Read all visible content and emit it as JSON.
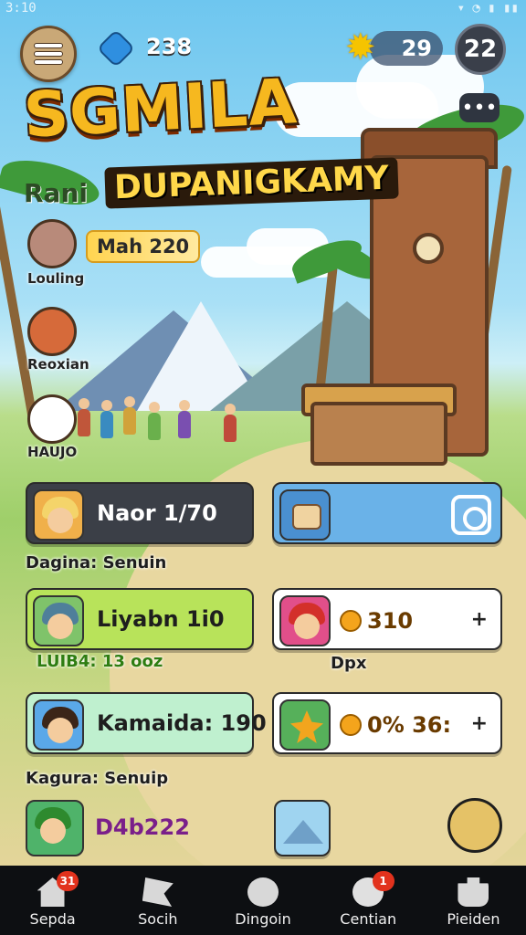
{
  "status": {
    "time": "3:10",
    "icons": "▾ ◔ ▮ ▮▮"
  },
  "hud": {
    "gems": "238",
    "stars": "29",
    "profile_text": "22",
    "chat_text": "•••"
  },
  "title": {
    "main": "SGMILA",
    "subtitle": "DUPANIGKAMY",
    "rank_label": "Rani"
  },
  "side": {
    "month_badge": "Mah 220",
    "labels": [
      "Louling",
      "Reoxian",
      "HAUJO"
    ]
  },
  "cards": [
    {
      "text": "Naor 1/70",
      "sub": "Dagina: Senuin"
    },
    {
      "text": "Liyabn 1i0",
      "sub": "LUIB4: 13 ooz"
    },
    {
      "text": "Kamaida: 190",
      "sub": "Kagura: Senuip"
    },
    {
      "text": "D4b222",
      "sub": ""
    }
  ],
  "right_cards": [
    {
      "bonus": "310",
      "plus": "+",
      "portrait_label": "",
      "sub": "Dpx"
    },
    {
      "bonus": "0% 36:",
      "plus": "+",
      "portrait_label": "",
      "sub": ""
    }
  ],
  "nav": [
    {
      "label": "Sepda",
      "icon": "home-icon",
      "badge": "31"
    },
    {
      "label": "Socih",
      "icon": "flag-icon",
      "badge": ""
    },
    {
      "label": "Dingoin",
      "icon": "globe-icon",
      "badge": ""
    },
    {
      "label": "Centian",
      "icon": "face-icon",
      "badge": "1"
    },
    {
      "label": "Pieiden",
      "icon": "puzzle-icon",
      "badge": ""
    }
  ],
  "colors": {
    "title": "#f6b81f",
    "nav_bg": "#0d0f12",
    "badge": "#e2321d",
    "card_green": "#b8e35a",
    "card_blue": "#6ab2e8"
  }
}
